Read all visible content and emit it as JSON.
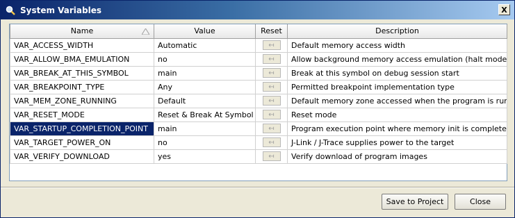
{
  "window": {
    "title": "System Variables",
    "close_glyph": "X"
  },
  "table": {
    "columns": [
      "Name",
      "Value",
      "Reset",
      "Description"
    ],
    "reset_glyph": "↤",
    "rows": [
      {
        "name": "VAR_ACCESS_WIDTH",
        "value": "Automatic",
        "description": "Default memory access width"
      },
      {
        "name": "VAR_ALLOW_BMA_EMULATION",
        "value": "no",
        "description": "Allow background memory access emulation (halt mode)"
      },
      {
        "name": "VAR_BREAK_AT_THIS_SYMBOL",
        "value": "main",
        "description": "Break at this symbol on debug session start"
      },
      {
        "name": "VAR_BREAKPOINT_TYPE",
        "value": "Any",
        "description": "Permitted breakpoint implementation type"
      },
      {
        "name": "VAR_MEM_ZONE_RUNNING",
        "value": "Default",
        "description": "Default memory zone accessed when the program is running"
      },
      {
        "name": "VAR_RESET_MODE",
        "value": "Reset & Break At Symbol",
        "description": "Reset mode"
      },
      {
        "name": "VAR_STARTUP_COMPLETION_POINT",
        "value": "main",
        "description": "Program execution point where memory init is complete",
        "selected": true
      },
      {
        "name": "VAR_TARGET_POWER_ON",
        "value": "no",
        "description": "J-Link / J-Trace supplies power to the target"
      },
      {
        "name": "VAR_VERIFY_DOWNLOAD",
        "value": "yes",
        "description": "Verify download of program images"
      }
    ]
  },
  "buttons": {
    "save_label": "Save to Project",
    "close_label": "Close"
  },
  "colors": {
    "titlebar": "#0a246a",
    "selection": "#0a246a"
  }
}
